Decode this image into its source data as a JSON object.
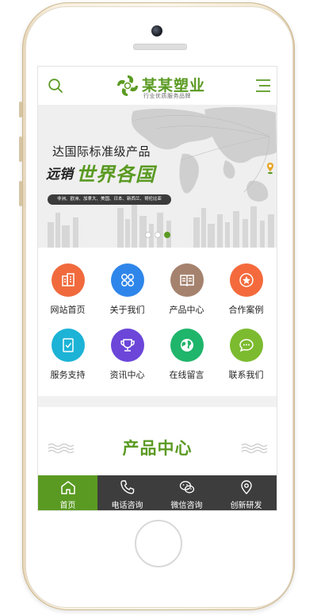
{
  "header": {
    "brand_title": "某某塑业",
    "brand_subtitle": "行业优质服务品牌"
  },
  "banner": {
    "line1": "达国际标准级产品",
    "line2_prefix": "远销",
    "line2_highlight": "世界各国",
    "tag": "非洲、欧洲、加拿大、美国、日本、新西兰、哥伦比亚",
    "slides_total": 3,
    "active_slide": 3
  },
  "grid": {
    "items": [
      {
        "label": "网站首页",
        "icon": "building-icon",
        "color": "#f06a3d"
      },
      {
        "label": "关于我们",
        "icon": "clover-icon",
        "color": "#2f86ea"
      },
      {
        "label": "产品中心",
        "icon": "book-icon",
        "color": "#a5826e"
      },
      {
        "label": "合作案例",
        "icon": "badge-star-icon",
        "color": "#f46a3c"
      },
      {
        "label": "服务支持",
        "icon": "document-check-icon",
        "color": "#1cb3d6"
      },
      {
        "label": "资讯中心",
        "icon": "trophy-icon",
        "color": "#6b46d9"
      },
      {
        "label": "在线留言",
        "icon": "globe-icon",
        "color": "#1fb56b"
      },
      {
        "label": "联系我们",
        "icon": "chat-bubble-icon",
        "color": "#7cbb2f"
      }
    ]
  },
  "section": {
    "title": "产品中心"
  },
  "bottom_nav": {
    "items": [
      {
        "label": "首页",
        "icon": "home-icon"
      },
      {
        "label": "电话咨询",
        "icon": "phone-icon"
      },
      {
        "label": "微信咨询",
        "icon": "wechat-icon"
      },
      {
        "label": "创新研发",
        "icon": "location-pin-icon"
      }
    ],
    "active_index": 0
  },
  "colors": {
    "brand_green": "#5a9a22",
    "nav_dark": "#3d3d3d",
    "phone_gold": "#e9dcc1"
  }
}
